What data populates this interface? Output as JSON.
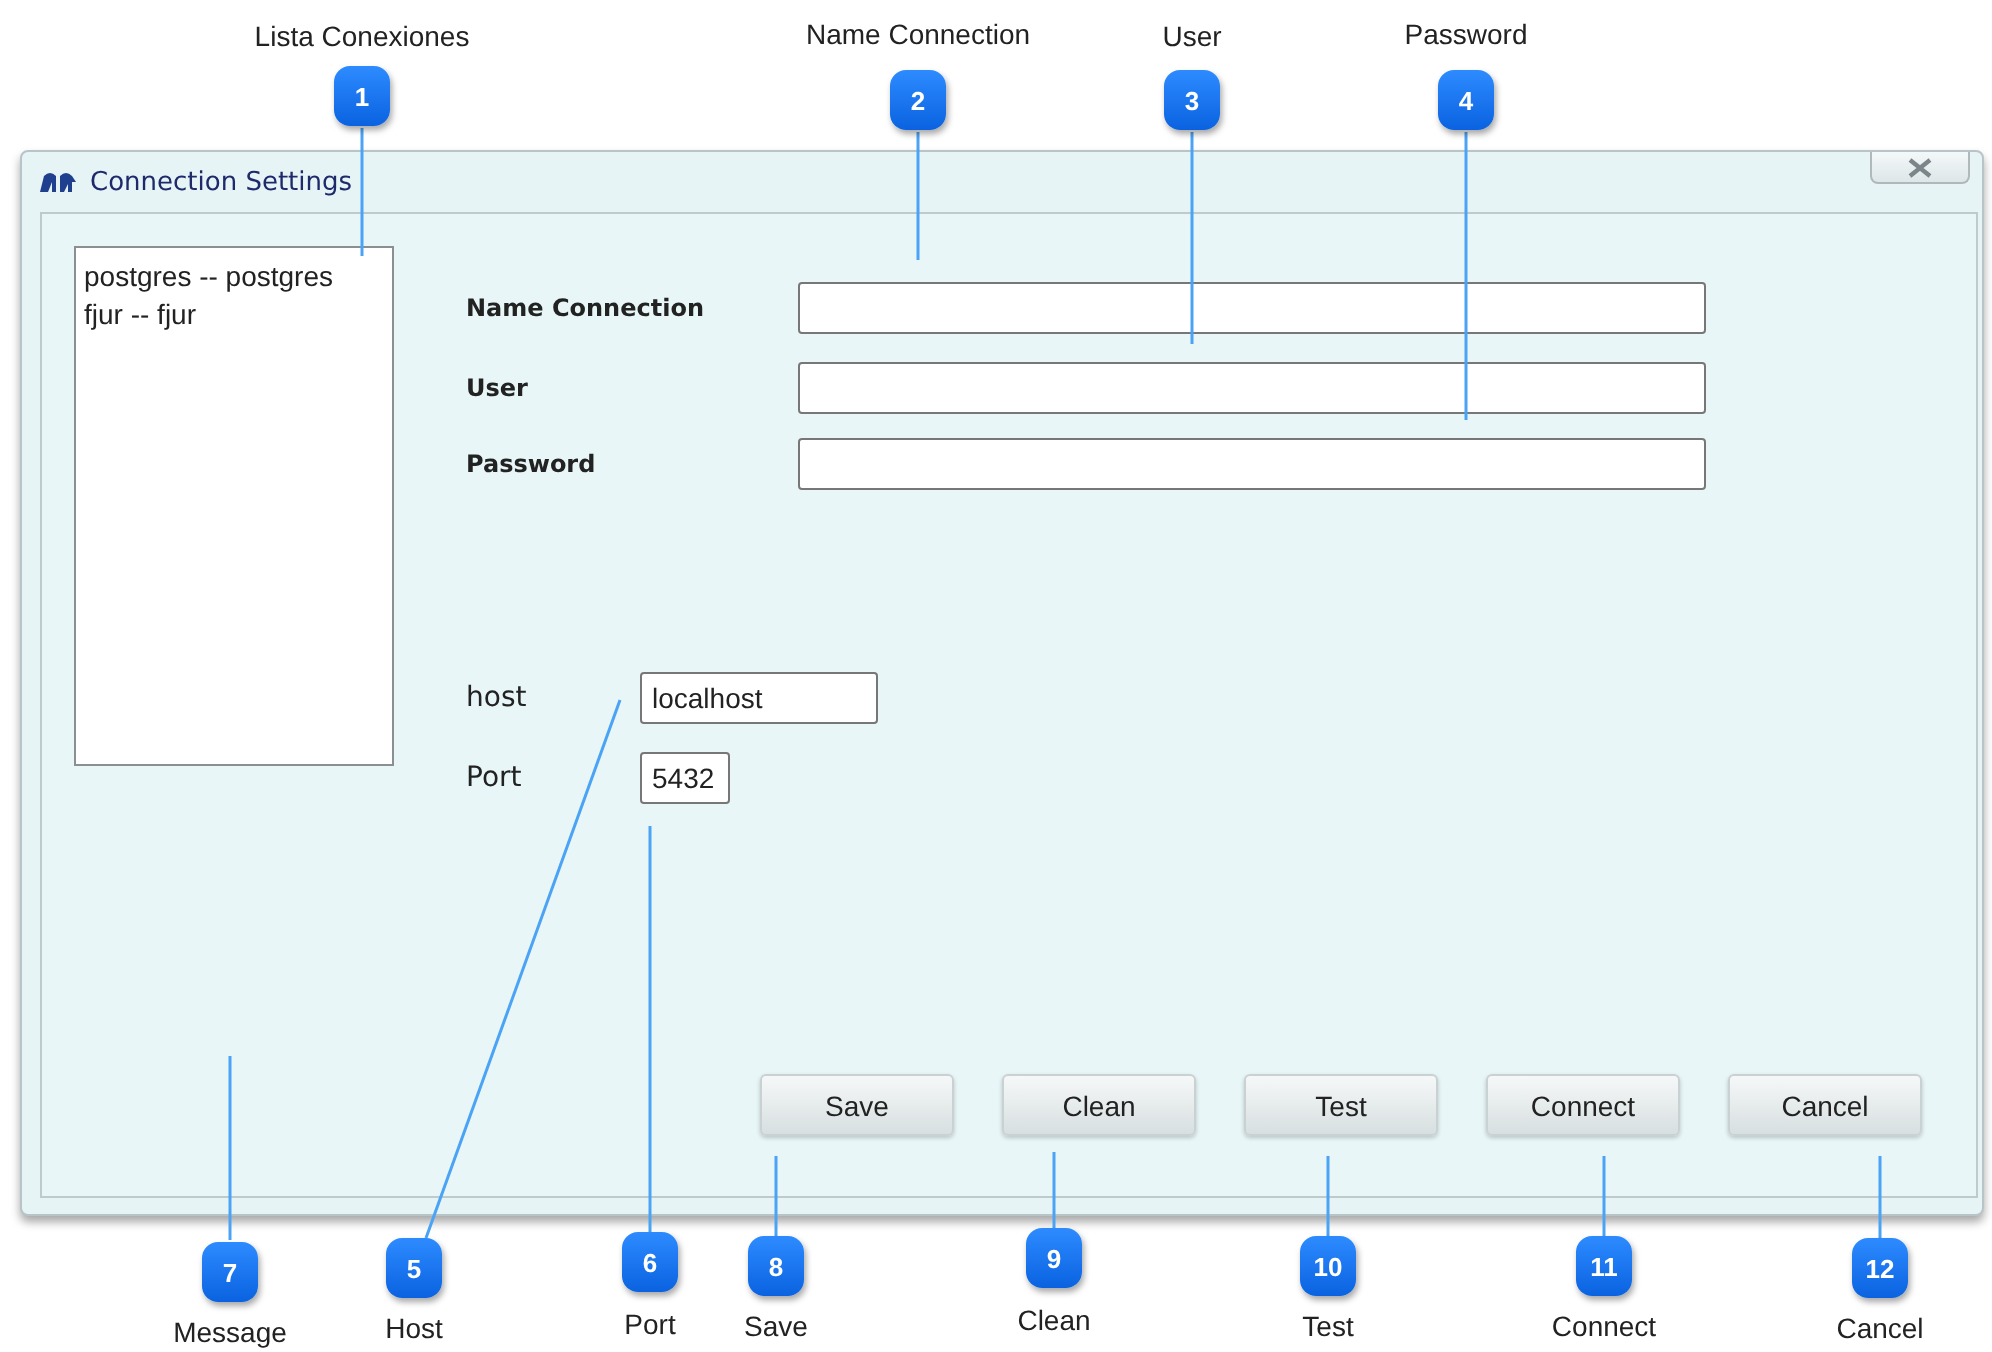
{
  "window": {
    "title": "Connection Settings"
  },
  "connection_list": [
    "postgres -- postgres",
    "fjur -- fjur"
  ],
  "credentials": [
    {
      "label": "Name Connection"
    },
    {
      "label": "User"
    },
    {
      "label": "Password"
    }
  ],
  "server": [
    {
      "label": "host",
      "value": "localhost"
    },
    {
      "label": "Port",
      "value": "5432"
    }
  ],
  "buttons": [
    "Save",
    "Clean",
    "Test",
    "Connect",
    "Cancel"
  ],
  "callouts": [
    {
      "number": "1",
      "label": "Lista Conexiones"
    },
    {
      "number": "2",
      "label": "Name Connection"
    },
    {
      "number": "3",
      "label": "User"
    },
    {
      "number": "4",
      "label": "Password"
    },
    {
      "number": "7",
      "label": "Message"
    },
    {
      "number": "5",
      "label": "Host"
    },
    {
      "number": "6",
      "label": "Port"
    },
    {
      "number": "8",
      "label": "Save"
    },
    {
      "number": "9",
      "label": "Clean"
    },
    {
      "number": "10",
      "label": "Test"
    },
    {
      "number": "11",
      "label": "Connect"
    },
    {
      "number": "12",
      "label": "Cancel"
    }
  ]
}
